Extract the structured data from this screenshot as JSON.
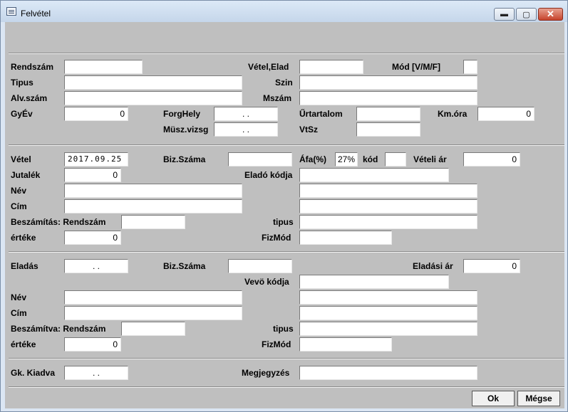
{
  "window": {
    "title": "Felvétel",
    "min_glyph": "▬",
    "max_glyph": "▢",
    "close_glyph": "✕"
  },
  "vehicle": {
    "rendszam_label": "Rendszám",
    "rendszam_value": "",
    "vetel_elad_label": "Vétel,Elad",
    "vetel_elad_value": "",
    "mod_label": "Mód [V/M/F]",
    "mod_value": "",
    "tipus_label": "Tipus",
    "tipus_value": "",
    "szin_label": "Szin",
    "szin_value": "",
    "alvszam_label": "Alv.szám",
    "alvszam_value": "",
    "mszam_label": "Mszám",
    "mszam_value": "",
    "gyev_label": "GyÉv",
    "gyev_value": "0",
    "forghely_label": "ForgHely",
    "forghely_value": ". .",
    "urtartalom_label": "Űrtartalom",
    "urtartalom_value": "",
    "kmora_label": "Km.óra",
    "kmora_value": "0",
    "muszvizsg_label": "Müsz.vizsg",
    "muszvizsg_value": ". .",
    "vtsz_label": "VtSz",
    "vtsz_value": ""
  },
  "purchase": {
    "vetel_label": "Vétel",
    "vetel_value": "2017.09.25",
    "bizszama_label": "Biz.Száma",
    "bizszama_value": "",
    "afa_label": "Áfa(%)",
    "afa_value": "27%",
    "kod_label": "kód",
    "kod_value": "",
    "veteliar_label": "Vételi ár",
    "veteliar_value": "0",
    "jutalek_label": "Jutalék",
    "jutalek_value": "0",
    "eladokodja_label": "Eladó kódja",
    "eladokodja_value": "",
    "nev_label": "Név",
    "nev_value": "",
    "nev2_value": "",
    "cim_label": "Cím",
    "cim_value": "",
    "cim2_value": "",
    "beszamitas_label": "Beszámítás: Rendszám",
    "beszamitas_value": "",
    "tipus_label": "tipus",
    "tipus_value": "",
    "erteke_label": "értéke",
    "erteke_value": "0",
    "fizmod_label": "FizMód",
    "fizmod_value": ""
  },
  "sale": {
    "eladas_label": "Eladás",
    "eladas_value": ". .",
    "bizszama_label": "Biz.Száma",
    "bizszama_value": "",
    "eladasiar_label": "Eladási ár",
    "eladasiar_value": "0",
    "vevokodja_label": "Vevö kódja",
    "vevokodja_value": "",
    "nev_label": "Név",
    "nev_value": "",
    "nev2_value": "",
    "cim_label": "Cím",
    "cim_value": "",
    "cim2_value": "",
    "beszamitva_label": "Beszámítva: Rendszám",
    "beszamitva_value": "",
    "tipus_label": "tipus",
    "tipus_value": "",
    "erteke_label": "értéke",
    "erteke_value": "0",
    "fizmod_label": "FizMód",
    "fizmod_value": ""
  },
  "footer": {
    "gkkiadva_label": "Gk. Kiadva",
    "gkkiadva_value": ". .",
    "megjegyzes_label": "Megjegyzés",
    "megjegyzes_value": ""
  },
  "buttons": {
    "ok_label": "Ok",
    "megse_label": "Mégse"
  }
}
